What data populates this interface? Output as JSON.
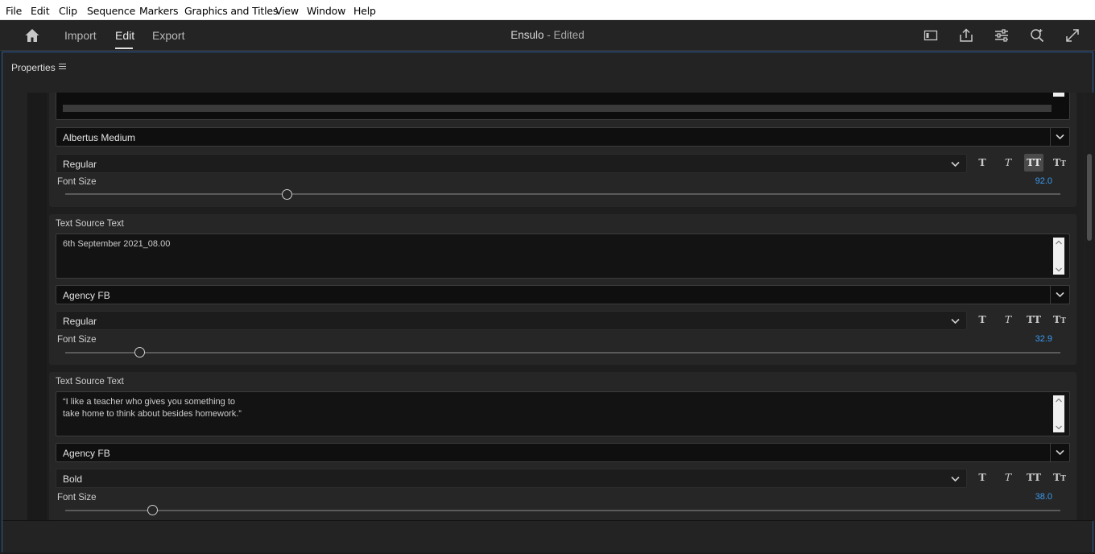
{
  "menubar": {
    "items": [
      "File",
      "Edit",
      "Clip",
      "Sequence",
      "Markers",
      "Graphics and Titles",
      "View",
      "Window",
      "Help"
    ]
  },
  "header": {
    "tabs": [
      "Import",
      "Edit",
      "Export"
    ],
    "active_tab": "Edit",
    "project_name": "Ensulo",
    "separator": " - ",
    "status": "Edited",
    "icons": [
      "home-icon",
      "panel-layout-icon",
      "share-icon",
      "sliders-icon",
      "zoom-search-icon",
      "fullscreen-icon"
    ]
  },
  "panel": {
    "title": "Properties",
    "menu_icon": "hamburger-icon"
  },
  "sections": [
    {
      "font": "Albertus Medium",
      "style": "Regular",
      "font_size_label": "Font Size",
      "font_size": "92.0",
      "font_size_fraction": 0.22,
      "active_style_button": "all-caps"
    },
    {
      "label": "Text Source Text",
      "text": "6th September 2021_08.00",
      "font": "Agency FB",
      "style": "Regular",
      "font_size_label": "Font Size",
      "font_size": "32.9",
      "font_size_fraction": 0.075
    },
    {
      "label": "Text Source Text",
      "text": "“I like a teacher who gives you something to\ntake home to think about besides homework.”",
      "font": "Agency FB",
      "style": "Bold",
      "font_size_label": "Font Size",
      "font_size": "38.0",
      "font_size_fraction": 0.088
    }
  ],
  "type_buttons": {
    "bold": "T",
    "italic": "T",
    "all_caps": "TT",
    "small_caps": "Tт"
  },
  "colors": {
    "accent_value": "#3a9bf0",
    "panel_focus_border": "#2b5d9e"
  }
}
